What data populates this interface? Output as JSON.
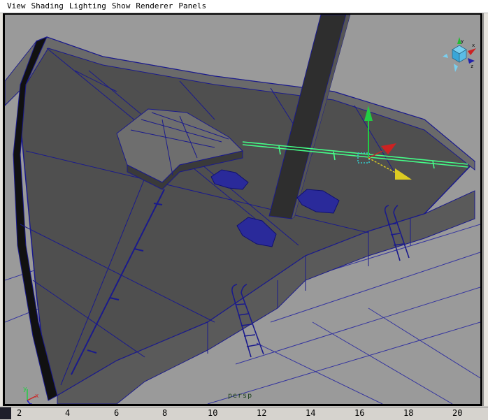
{
  "menu": {
    "items": [
      "View",
      "Shading",
      "Lighting",
      "Show",
      "Renderer",
      "Panels"
    ]
  },
  "viewport": {
    "camera_label": "persp",
    "view_cube_labels": {
      "x": "x",
      "y": "y",
      "z": "z"
    },
    "axis_labels": {
      "x": "x",
      "y": "y",
      "z": "z"
    }
  },
  "ruler": {
    "ticks": [
      "2",
      "4",
      "6",
      "8",
      "10",
      "12",
      "14",
      "16",
      "18",
      "20"
    ]
  },
  "colors": {
    "background": "#9a9a9a",
    "deck": "#4a4a4a",
    "wireframe": "#1a1a8c",
    "selection": "#44ff88",
    "manip_y": "#22cc44",
    "manip_x": "#cc2222",
    "manip_z": "#ddcc22"
  }
}
